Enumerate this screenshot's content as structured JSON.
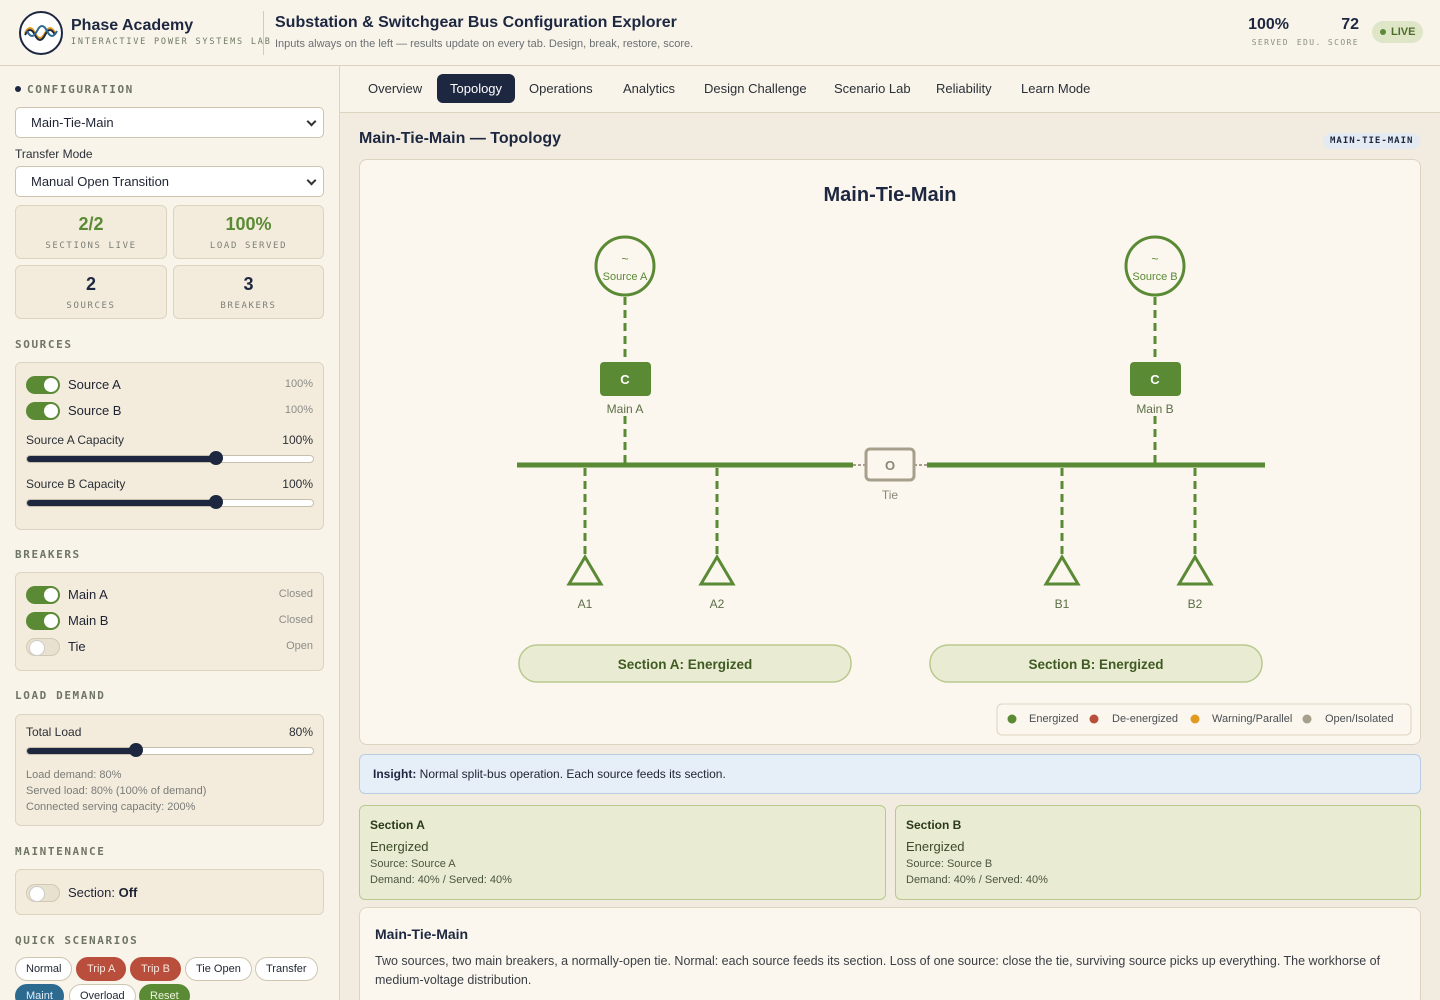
{
  "header": {
    "brand_name": "Phase Academy",
    "brand_tagline": "INTERACTIVE POWER SYSTEMS LAB",
    "app_title": "Substation & Switchgear Bus Configuration Explorer",
    "app_subtitle": "Inputs always on the left — results update on every tab. Design, break, restore, score.",
    "stats": [
      {
        "value": "100%",
        "label": "SERVED"
      },
      {
        "value": "72",
        "label": "EDU. SCORE"
      }
    ],
    "live_label": "LIVE"
  },
  "sidebar": {
    "config_heading": "CONFIGURATION",
    "config_value": "Main-Tie-Main",
    "transfer_label": "Transfer Mode",
    "transfer_value": "Manual Open Transition",
    "metrics": [
      {
        "value": "2/2",
        "label": "SECTIONS LIVE",
        "color": "#5b8a35"
      },
      {
        "value": "100%",
        "label": "LOAD SERVED",
        "color": "#5b8a35"
      },
      {
        "value": "2",
        "label": "SOURCES",
        "color": "#1d2740"
      },
      {
        "value": "3",
        "label": "BREAKERS",
        "color": "#1d2740"
      }
    ],
    "sources_heading": "SOURCES",
    "sources": [
      {
        "label": "Source A",
        "value": "100%",
        "on": true
      },
      {
        "label": "Source B",
        "value": "100%",
        "on": true
      }
    ],
    "capacity_sliders": [
      {
        "label": "Source A Capacity",
        "value": "100%",
        "level": 0.66
      },
      {
        "label": "Source B Capacity",
        "value": "100%",
        "level": 0.66
      }
    ],
    "breakers_heading": "BREAKERS",
    "breakers": [
      {
        "label": "Main A",
        "state": "Closed",
        "on": true
      },
      {
        "label": "Main B",
        "state": "Closed",
        "on": true
      },
      {
        "label": "Tie",
        "state": "Open",
        "on": false
      }
    ],
    "load_heading": "LOAD DEMAND",
    "total_load": {
      "label": "Total Load",
      "value": "80%",
      "level": 0.38
    },
    "load_lines": [
      "Load demand: 80%",
      "Served load: 80% (100% of demand)",
      "Connected serving capacity: 200%"
    ],
    "maintenance_heading": "MAINTENANCE",
    "maintenance_label": "Section:",
    "maintenance_value": "Off",
    "scenarios_heading": "QUICK SCENARIOS",
    "scenarios": [
      {
        "label": "Normal",
        "style": "plain"
      },
      {
        "label": "Trip A",
        "style": "red"
      },
      {
        "label": "Trip B",
        "style": "red"
      },
      {
        "label": "Tie Open",
        "style": "plain"
      },
      {
        "label": "Transfer",
        "style": "plain"
      },
      {
        "label": "Maint",
        "style": "blue"
      },
      {
        "label": "Overload",
        "style": "plain"
      },
      {
        "label": "Reset",
        "style": "green"
      }
    ]
  },
  "tabs": [
    "Overview",
    "Topology",
    "Operations",
    "Analytics",
    "Design Challenge",
    "Scenario Lab",
    "Reliability",
    "Learn Mode"
  ],
  "active_tab": "Topology",
  "main": {
    "page_title": "Main-Tie-Main — Topology",
    "config_badge": "MAIN-TIE-MAIN",
    "diagram": {
      "title": "Main-Tie-Main",
      "source_symbol": "~",
      "sources": [
        "Source A",
        "Source B"
      ],
      "breaker_symbol": "C",
      "breakers": [
        "Main A",
        "Main B"
      ],
      "tie_symbol": "O",
      "tie_label": "Tie",
      "loads": [
        "A1",
        "A2",
        "B1",
        "B2"
      ],
      "sections": [
        "Section A: Energized",
        "Section B: Energized"
      ],
      "legend": [
        {
          "label": "Energized",
          "color": "#5b8a35"
        },
        {
          "label": "De-energized",
          "color": "#b84e3b"
        },
        {
          "label": "Warning/Parallel",
          "color": "#e09a1f"
        },
        {
          "label": "Open/Isolated",
          "color": "#a59f8c"
        }
      ]
    },
    "insight_label": "Insight:",
    "insight_text": "Normal split-bus operation. Each source feeds its section.",
    "section_cards": [
      {
        "title": "Section A",
        "status": "Energized",
        "source": "Source: Source A",
        "demand": "Demand: 40% / Served: 40%"
      },
      {
        "title": "Section B",
        "status": "Energized",
        "source": "Source: Source B",
        "demand": "Demand: 40% / Served: 40%"
      }
    ],
    "description": {
      "title": "Main-Tie-Main",
      "text": "Two sources, two main breakers, a normally-open tie. Normal: each source feeds its section. Loss of one source: close the tie, surviving source picks up everything. The workhorse of medium-voltage distribution."
    }
  },
  "colors": {
    "navy": "#1d2740",
    "energized": "#5b8a35",
    "bg": "#f2ece0"
  }
}
